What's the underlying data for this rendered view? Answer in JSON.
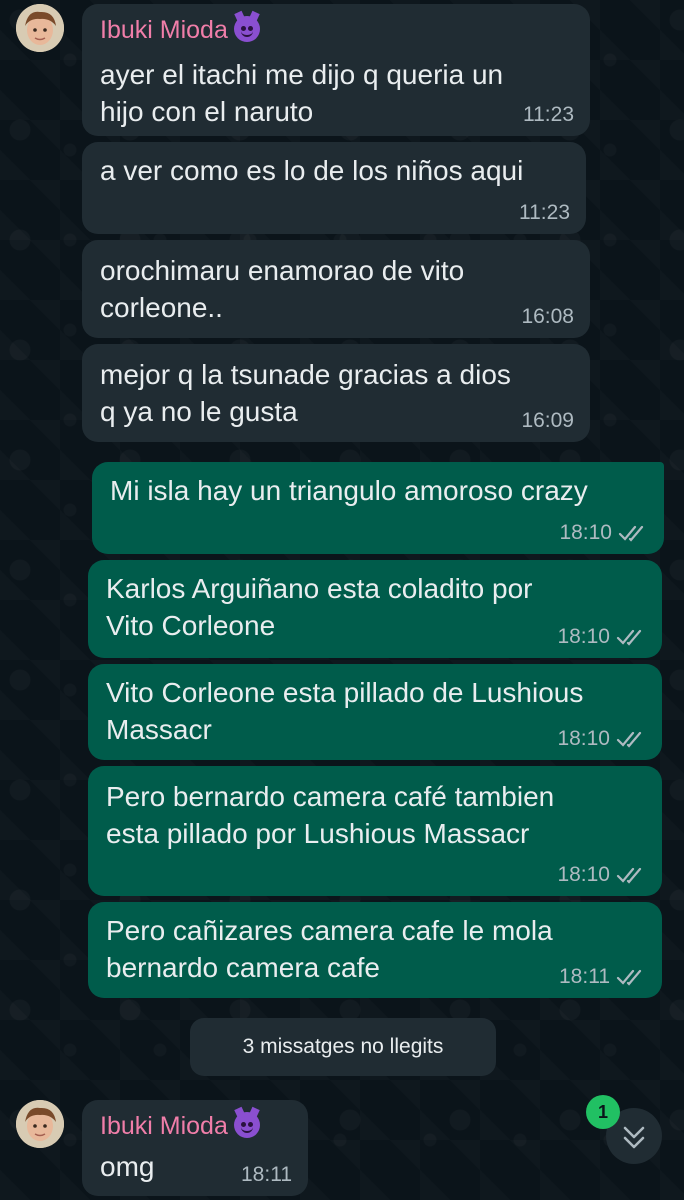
{
  "chat": {
    "sender_name": "Ibuki Mioda",
    "emoji_icon": "smiling-face-with-horns",
    "unread_banner": "3 missatges no llegits",
    "unread_count": "1",
    "messages": [
      {
        "dir": "in",
        "text": "ayer el itachi me dijo q queria un\nhijo con el naruto",
        "time": "11:23"
      },
      {
        "dir": "in",
        "text": "a ver como es lo de los niños aqui",
        "time": "11:23"
      },
      {
        "dir": "in",
        "text": "orochimaru enamorao de vito\ncorleone..",
        "time": "16:08"
      },
      {
        "dir": "in",
        "text": "mejor q la tsunade gracias a dios\nq ya no le gusta",
        "time": "16:09"
      },
      {
        "dir": "out",
        "text": "Mi isla hay un triangulo amoroso crazy",
        "time": "18:10"
      },
      {
        "dir": "out",
        "text": "Karlos Arguiñano esta coladito por\nVito Corleone",
        "time": "18:10"
      },
      {
        "dir": "out",
        "text": "Vito Corleone esta pillado de Lushious\nMassacr",
        "time": "18:10"
      },
      {
        "dir": "out",
        "text": "Pero bernardo camera café tambien\nesta pillado por Lushious Massacr",
        "time": "18:10"
      },
      {
        "dir": "out",
        "text": "Pero cañizares camera cafe le mola\nbernardo camera cafe",
        "time": "18:11"
      },
      {
        "dir": "in",
        "text": "omg",
        "time": "18:11"
      }
    ]
  }
}
